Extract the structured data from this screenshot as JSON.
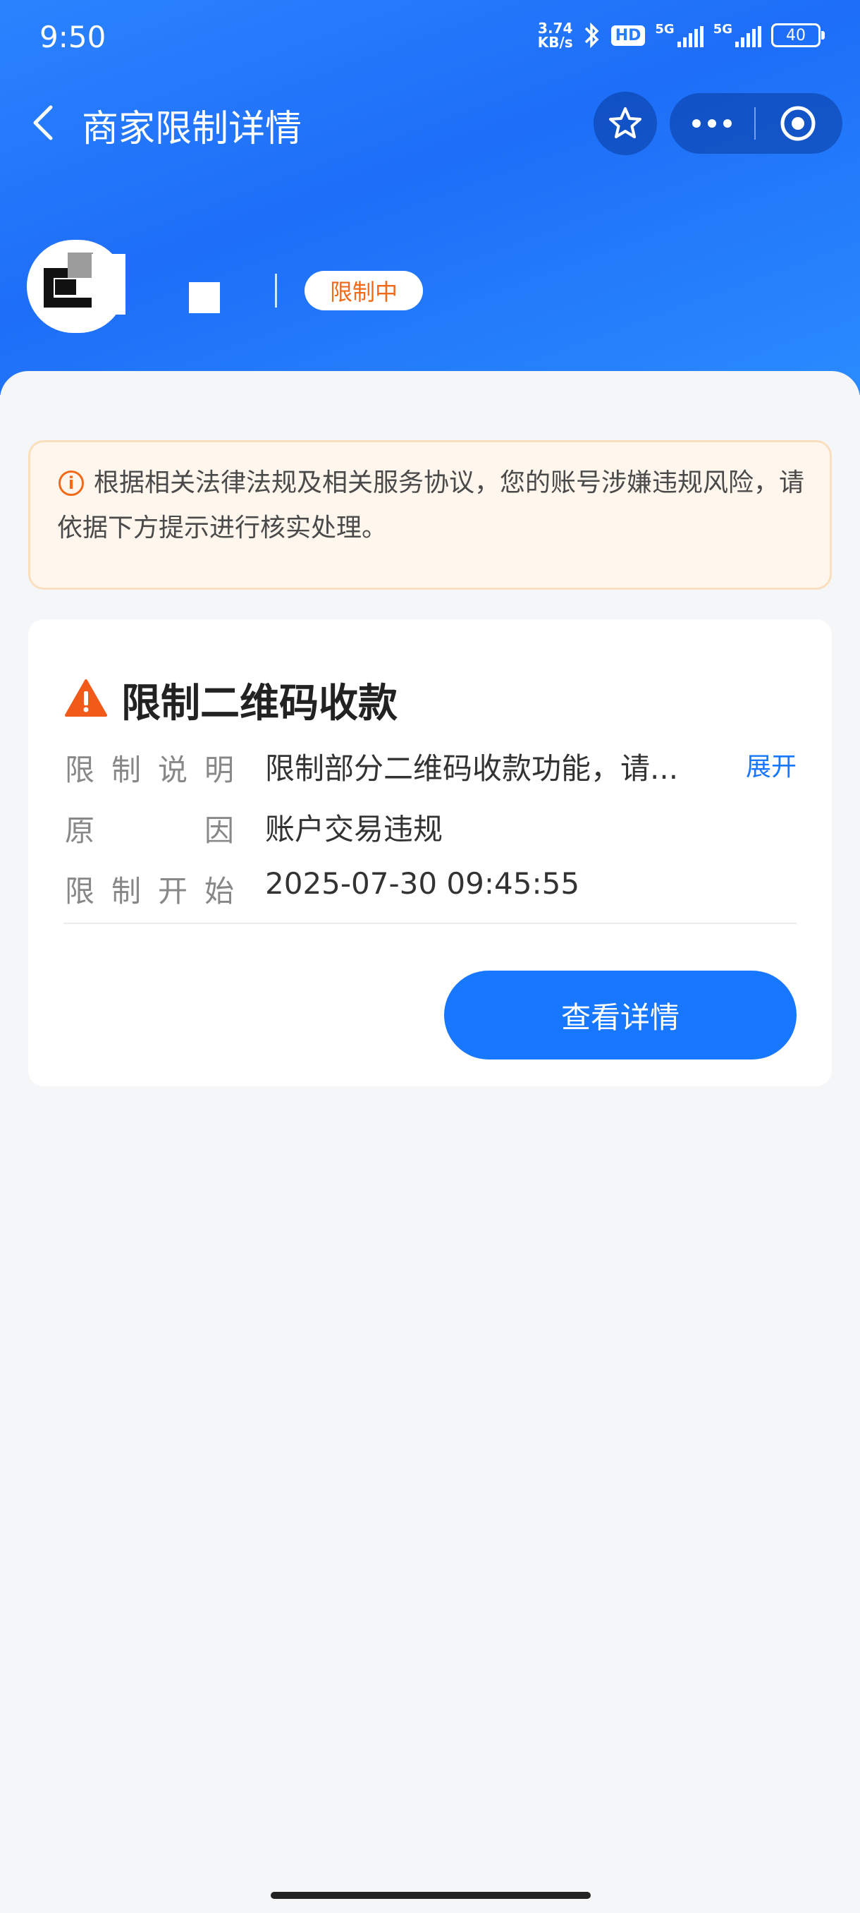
{
  "status_bar": {
    "time": "9:50",
    "net_speed_value": "3.74",
    "net_speed_unit": "KB/s",
    "hd_label": "HD",
    "signal1": "5G",
    "signal2": "5G",
    "battery": "40"
  },
  "nav": {
    "title": "商家限制详情"
  },
  "merchant": {
    "status_badge": "限制中"
  },
  "notice": {
    "text": "根据相关法律法规及相关服务协议，您的账号涉嫌违规风险，请依据下方提示进行核实处理。"
  },
  "restriction": {
    "title": "限制二维码收款",
    "rows": [
      {
        "label_chars": [
          "限",
          "制",
          "说",
          "明"
        ],
        "value": "限制部分二维码收款功能，请..."
      },
      {
        "label_chars": [
          "原",
          "因"
        ],
        "value": "账户交易违规"
      },
      {
        "label_chars": [
          "限",
          "制",
          "开",
          "始"
        ],
        "value": "2025-07-30 09:45:55"
      }
    ],
    "expand_label": "展开",
    "detail_button": "查看详情"
  },
  "colors": {
    "header_blue": "#1e6ef7",
    "accent_blue": "#1777ff",
    "warning_orange": "#f26a17",
    "notice_bg": "#fff7ee"
  }
}
